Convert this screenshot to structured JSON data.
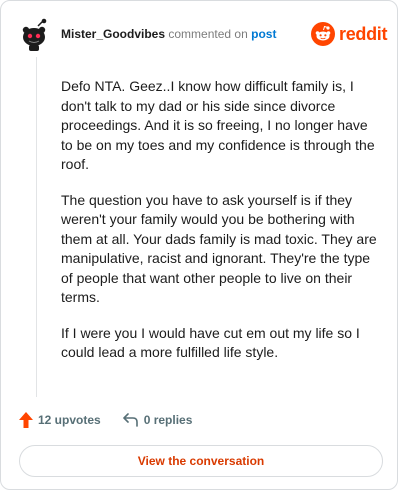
{
  "comment": {
    "username": "Mister_Goodvibes",
    "action_text": "commented on",
    "target_link": "post",
    "paragraphs": [
      "Defo NTA. Geez..I know how difficult family is, I don't talk to my dad or his side since divorce proceedings. And it is so freeing, I no longer have to be on my toes and my confidence is through the roof.",
      "The question you have to ask yourself is if they weren't your family would you be bothering with them at all. Your dads family is mad toxic. They are manipulative, racist and ignorant. They're the type of people that want other people to live on their terms.",
      "If I were you I would have cut em out my life so I could lead a more fulfilled life style."
    ]
  },
  "brand": {
    "logo_text": "reddit",
    "icon": "reddit-alien-icon",
    "color": "#ff4500"
  },
  "footer": {
    "upvotes_label": "12 upvotes",
    "replies_label": "0 replies",
    "upvote_icon": "upvote-arrow-icon",
    "reply_icon": "reply-arrow-icon",
    "upvote_color": "#ff4500"
  },
  "cta": {
    "label": "View the conversation",
    "color": "#d93a00"
  },
  "avatar": {
    "icon": "snoo-avatar-icon"
  }
}
